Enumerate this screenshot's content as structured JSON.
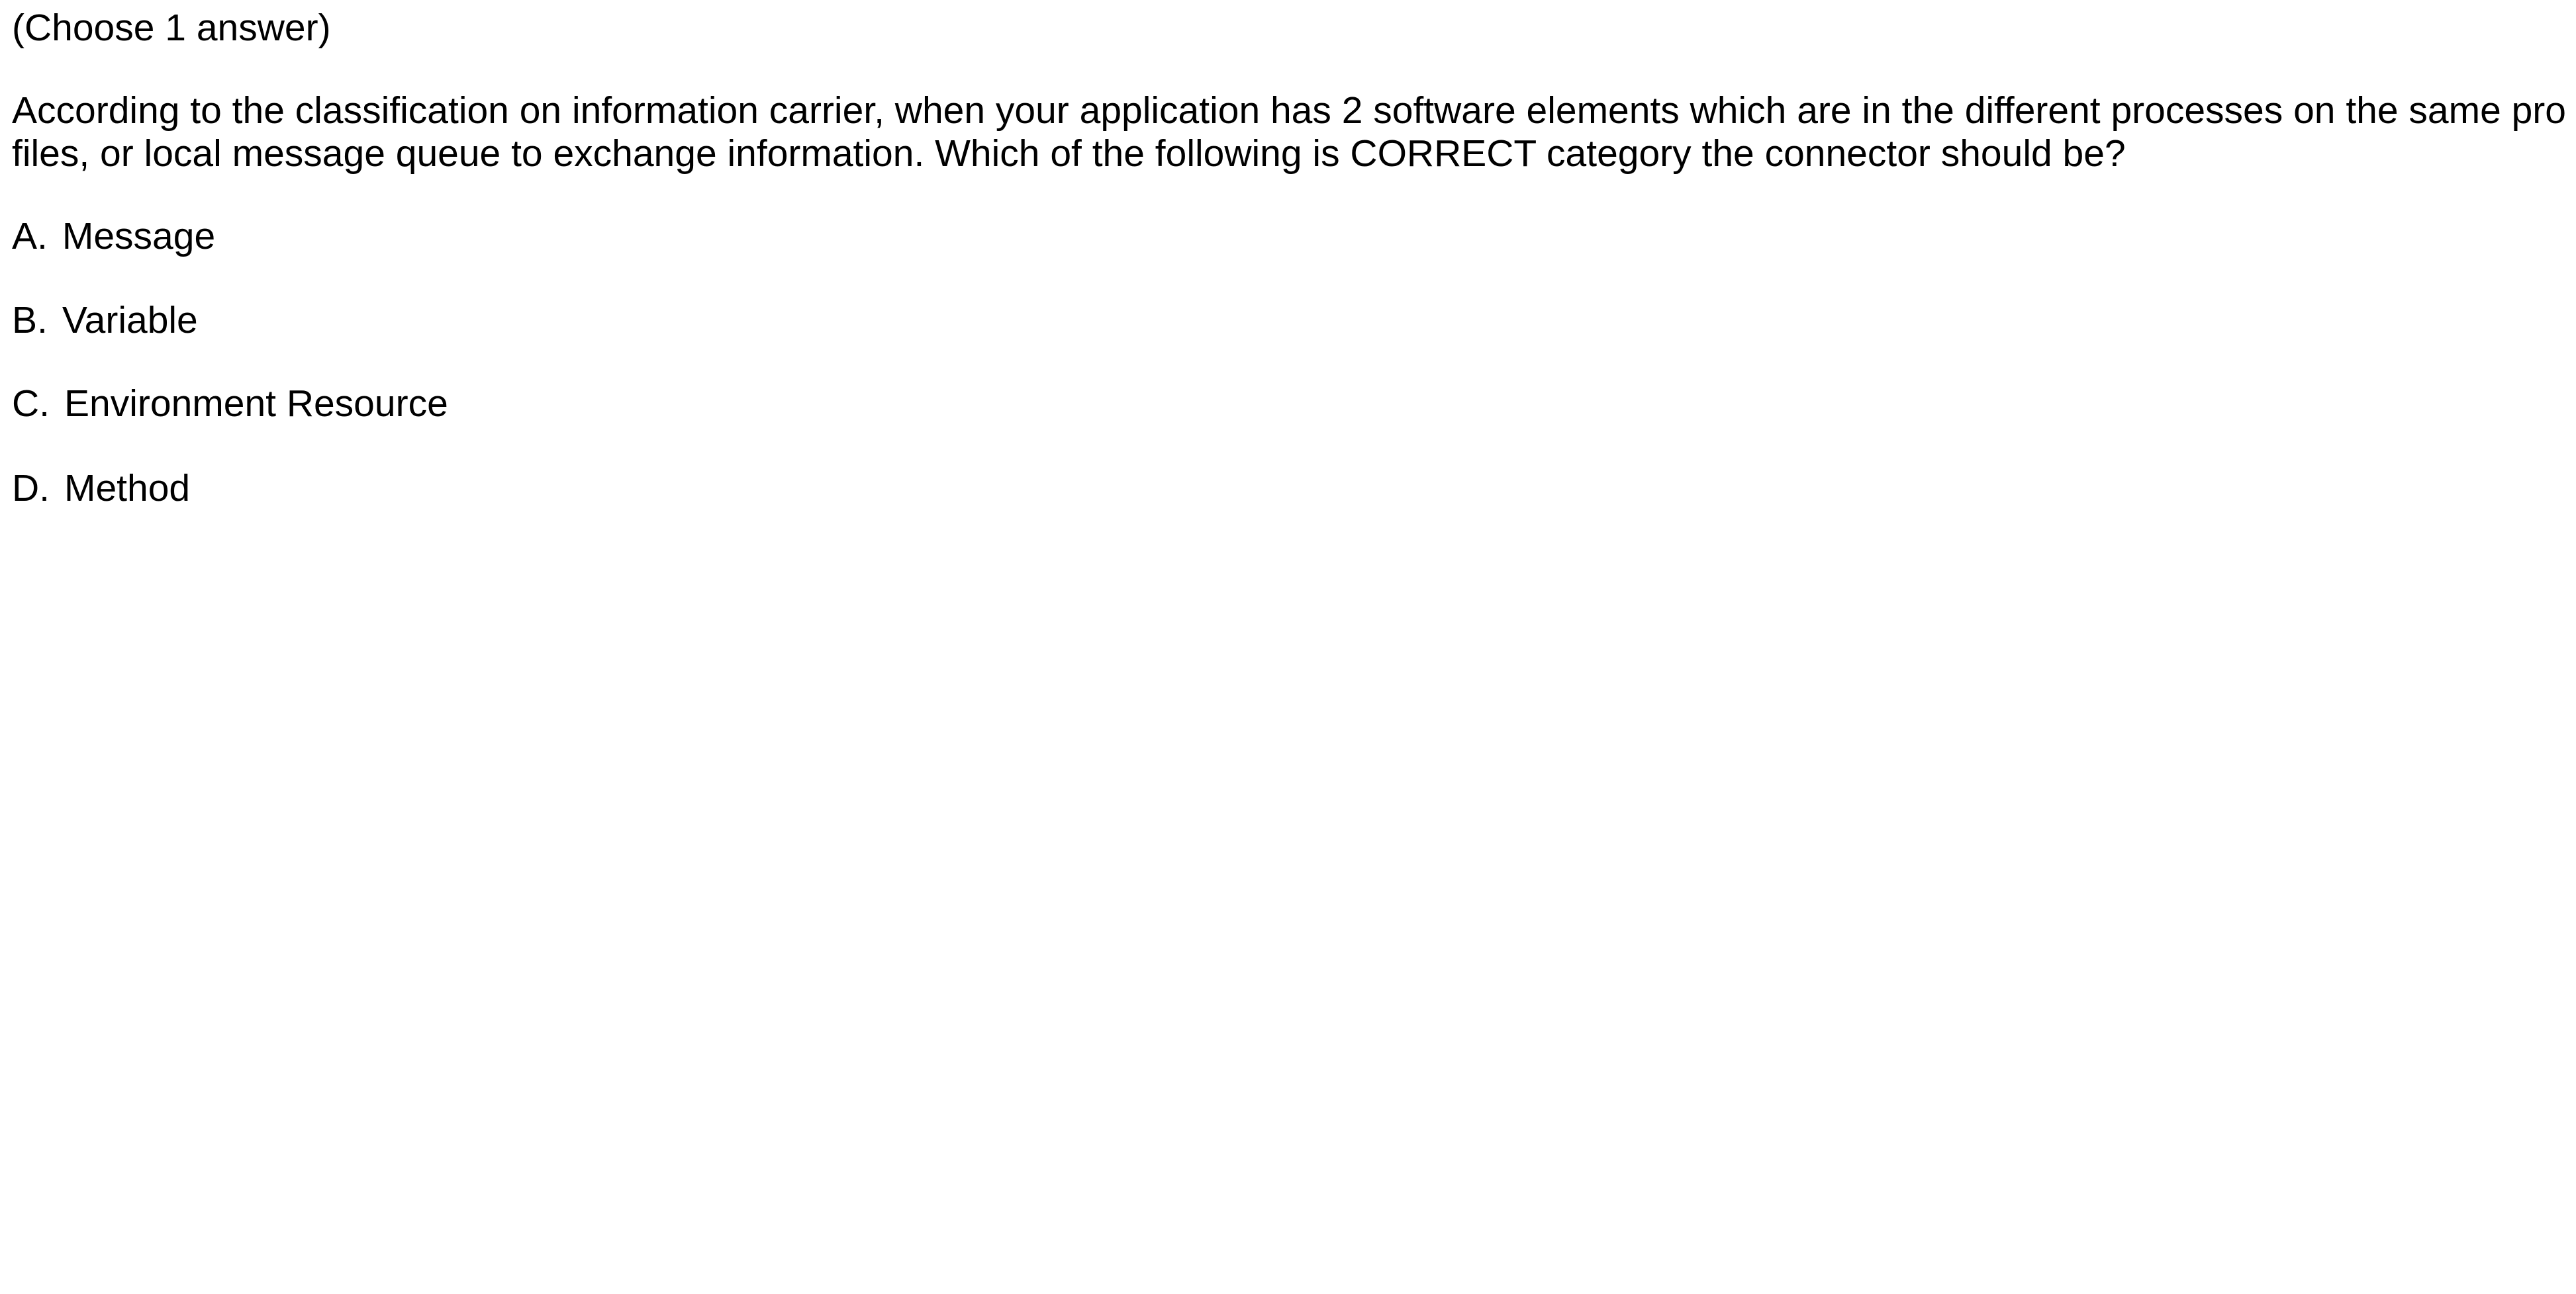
{
  "question": {
    "instruction": "(Choose 1 answer)",
    "stem_line_1": "According to the classification on information carrier, when your application has 2 software elements which are in the different processes on the same pro",
    "stem_line_2": "files, or local message queue to exchange information. Which of the following is CORRECT category the connector should be?"
  },
  "options": [
    {
      "letter": "A.",
      "text": "Message"
    },
    {
      "letter": "B.",
      "text": "Variable"
    },
    {
      "letter": "C.",
      "text": "Environment Resource"
    },
    {
      "letter": "D.",
      "text": "Method"
    }
  ]
}
